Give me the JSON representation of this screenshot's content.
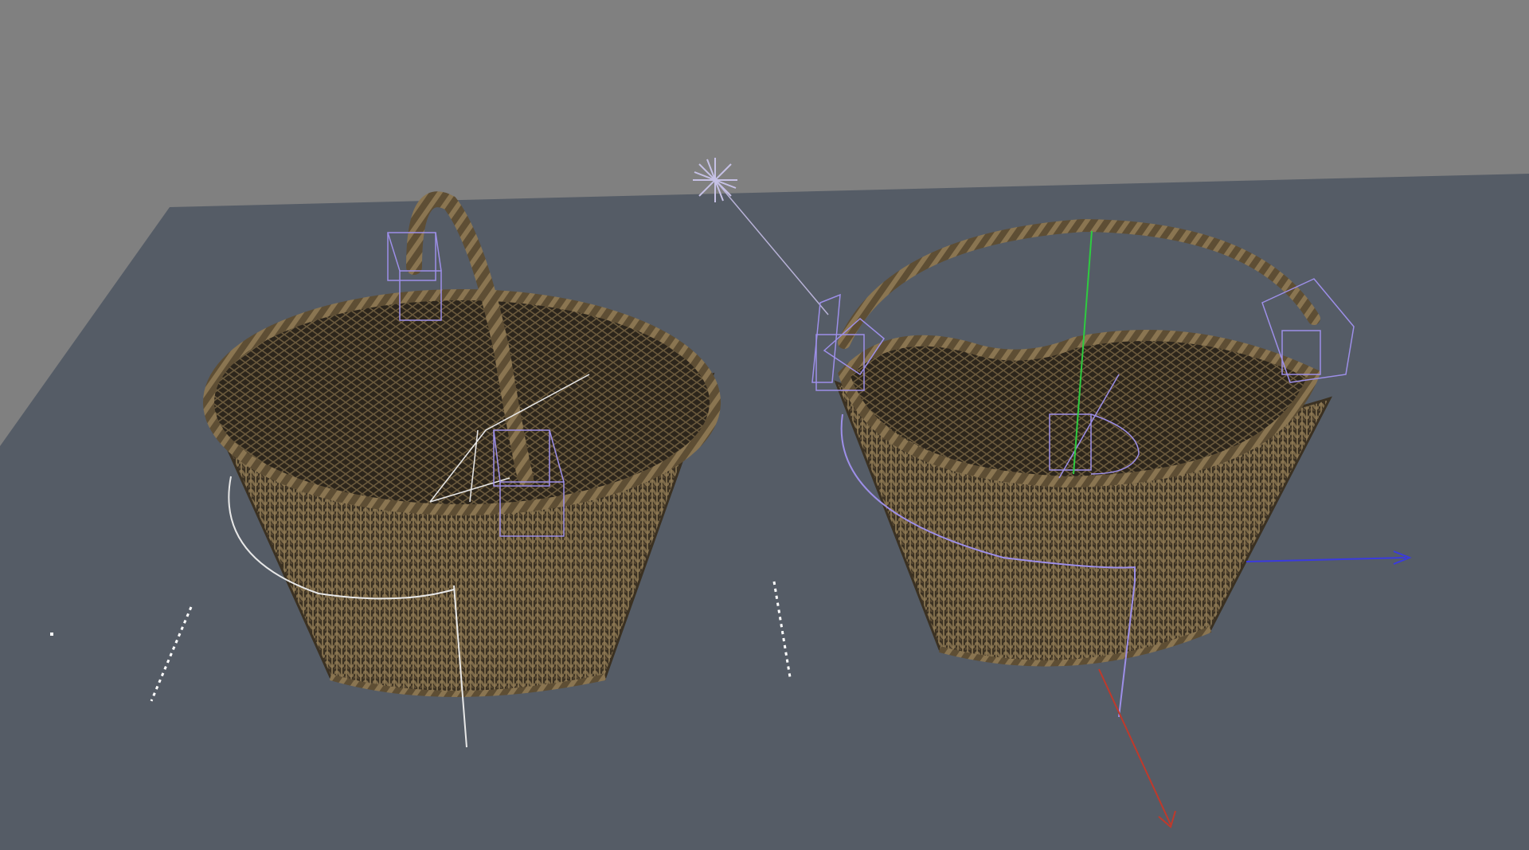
{
  "viewport": {
    "background_color": "#808080",
    "floor_color": "#555c66",
    "floor_edge_color": "#5e6570"
  },
  "colors": {
    "wicker_dark": "#3b3122",
    "wicker_mid": "#6e5c3e",
    "wicker_light": "#8f7a55",
    "gizmo_violet": "#9d8fe8",
    "gizmo_white": "#e8e8e8",
    "axis_x": "#c0392b",
    "axis_y": "#2ecc40",
    "axis_z": "#3a3adf"
  },
  "scene": {
    "objects": [
      {
        "name": "basket-left",
        "icon": "wicker-basket-with-arched-handle"
      },
      {
        "name": "basket-right",
        "icon": "wicker-basket-with-two-side-handles"
      },
      {
        "name": "point-light",
        "icon": "star-light-icon"
      }
    ]
  }
}
